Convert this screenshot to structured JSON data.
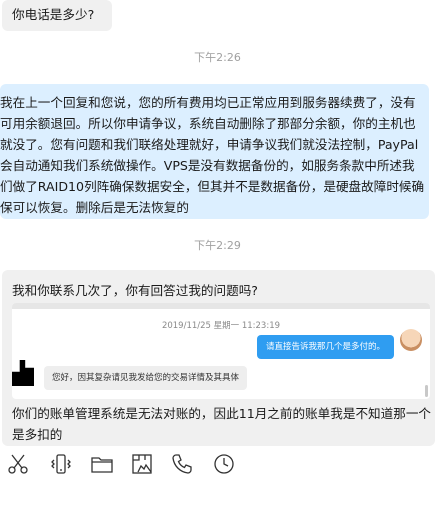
{
  "messages": {
    "m1": "你电话是多少?",
    "t1": "下午2:26",
    "m2": "我在上一个回复和您说，您的所有费用均已正常应用到服务器续费了，没有可用余额退回。所以你申请争议，系统自动删除了那部分余额，你的主机也就没了。您有问题和我们联络处理就好，申请争议我们就没法控制，PayPal会自动通知我们系统做操作。VPS是没有数据备份的，如服务条款中所述我们做了RAID10列阵确保数据安全，但其并不是数据备份，是硬盘故障时候确保可以恢复。删除后是无法恢复的",
    "t2": "下午2:29",
    "m3_head": "我和你联系几次了，你有回答过我的问题吗?",
    "m3_tail": "你们的账单管理系统是无法对账的，因此11月之前的账单我是不知道那一个是多扣的"
  },
  "quote": {
    "stamp": "2019/11/25 星期一 11:23:19",
    "right_text": "请直接告诉我那几个是多付的。",
    "left_text": "您好，因其复杂请见我发给您的交易详情及其具体"
  },
  "toolbar": {
    "icons": [
      "scissors-icon",
      "phone-shake-icon",
      "folder-icon",
      "image-icon",
      "phone-icon",
      "clock-icon"
    ]
  }
}
